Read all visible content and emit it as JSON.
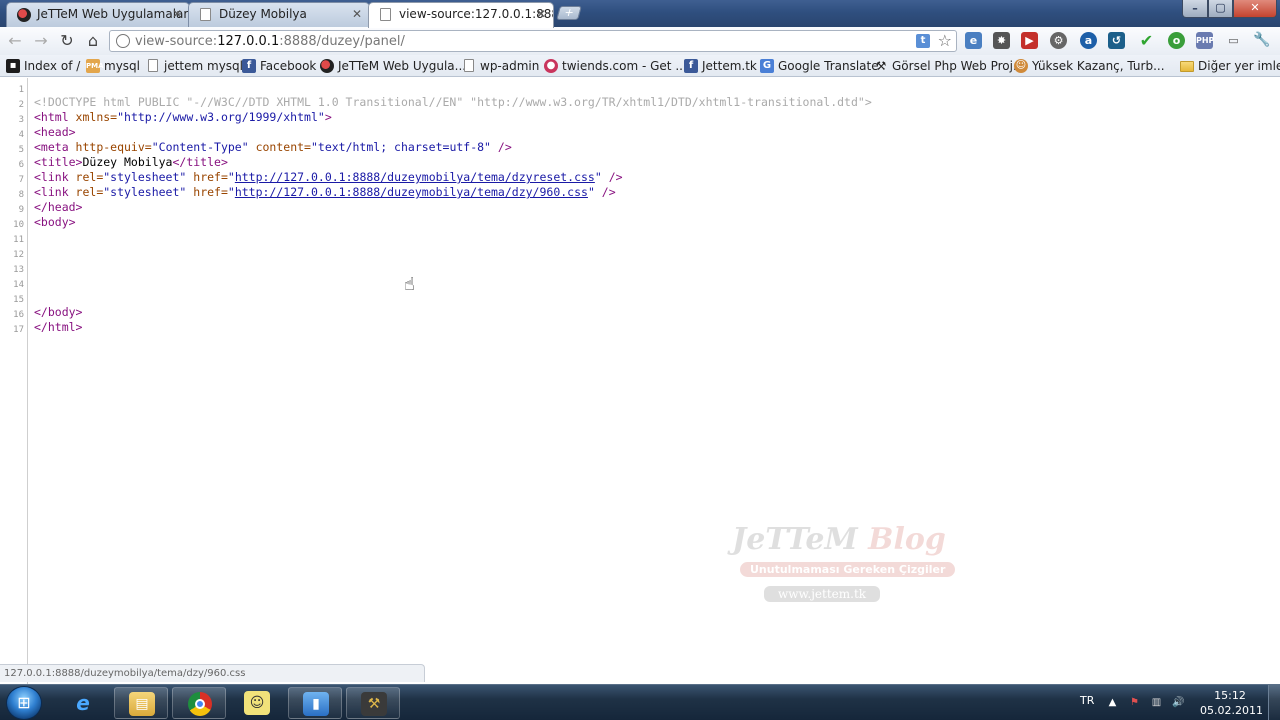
{
  "tabs": [
    {
      "title": "JeTTeM Web Uygulamaları"
    },
    {
      "title": "Düzey Mobilya"
    },
    {
      "title": "view-source:127.0.0.1:8888..."
    }
  ],
  "omnibox": {
    "prefix": "view-source:",
    "host": "127.0.0.1",
    "rest": ":8888/duzey/panel/"
  },
  "icons": {
    "back": "back-arrow-icon",
    "forward": "forward-arrow-icon",
    "reload": "reload-icon",
    "home": "home-icon",
    "star": "star-icon",
    "wrench": "wrench-icon"
  },
  "bookmarks": [
    {
      "label": "Index of /"
    },
    {
      "label": "mysql"
    },
    {
      "label": "jettem mysql"
    },
    {
      "label": "Facebook"
    },
    {
      "label": "JeTTeM Web Uygula..."
    },
    {
      "label": "wp-admin"
    },
    {
      "label": "twiends.com - Get ..."
    },
    {
      "label": "Jettem.tk"
    },
    {
      "label": "Google Translate"
    },
    {
      "label": "Görsel Php Web Proj..."
    },
    {
      "label": "Yüksek Kazanç, Turb..."
    }
  ],
  "other_bookmarks": "Diğer yer imleri",
  "source": {
    "line_numbers": [
      "1",
      "2",
      "3",
      "4",
      "5",
      "6",
      "7",
      "8",
      "9",
      "10",
      "11",
      "12",
      "13",
      "14",
      "15",
      "16",
      "17"
    ],
    "doctype": "<!DOCTYPE html PUBLIC \"-//W3C//DTD XHTML 1.0 Transitional//EN\" \"http://www.w3.org/TR/xhtml1/DTD/xhtml1-transitional.dtd\">",
    "html_open_tag": "<html",
    "html_attr": " xmlns=",
    "html_val": "\"http://www.w3.org/1999/xhtml\"",
    "close": ">",
    "head_open": "<head>",
    "meta_tag": "<meta",
    "meta_attr1": " http-equiv=",
    "meta_val1": "\"Content-Type\"",
    "meta_attr2": " content=",
    "meta_val2": "\"text/html; charset=utf-8\"",
    "selfclose": " />",
    "title_open": "<title>",
    "title_text": "Düzey Mobilya",
    "title_close": "</title>",
    "link_tag": "<link",
    "link_attr_rel": " rel=",
    "link_val_rel": "\"stylesheet\"",
    "link_attr_href": " href=",
    "quote": "\"",
    "link1_href": "http://127.0.0.1:8888/duzeymobilya/tema/dzyreset.css",
    "link2_href": "http://127.0.0.1:8888/duzeymobilya/tema/dzy/960.css",
    "head_close": "</head>",
    "body_open": "<body>",
    "body_close": "</body>",
    "html_close": "</html>"
  },
  "watermark": {
    "title_a": "JeTTeM ",
    "title_b": "Blog",
    "subtitle": "Unutulmaması Gereken Çizgiler",
    "url": "www.jettem.tk"
  },
  "status_url": "127.0.0.1:8888/duzeymobilya/tema/dzy/960.css",
  "taskbar": {
    "apps": [
      "internet-explorer-icon",
      "windows-explorer-icon",
      "chrome-icon",
      "notepad-icon",
      "document-icon",
      "tool-icon"
    ],
    "lang": "TR",
    "time": "15:12",
    "date": "05.02.2011"
  },
  "colors": {
    "tag": "#881280",
    "attr": "#994500",
    "value": "#1a1aa6",
    "doctype": "#aaaaaa"
  }
}
